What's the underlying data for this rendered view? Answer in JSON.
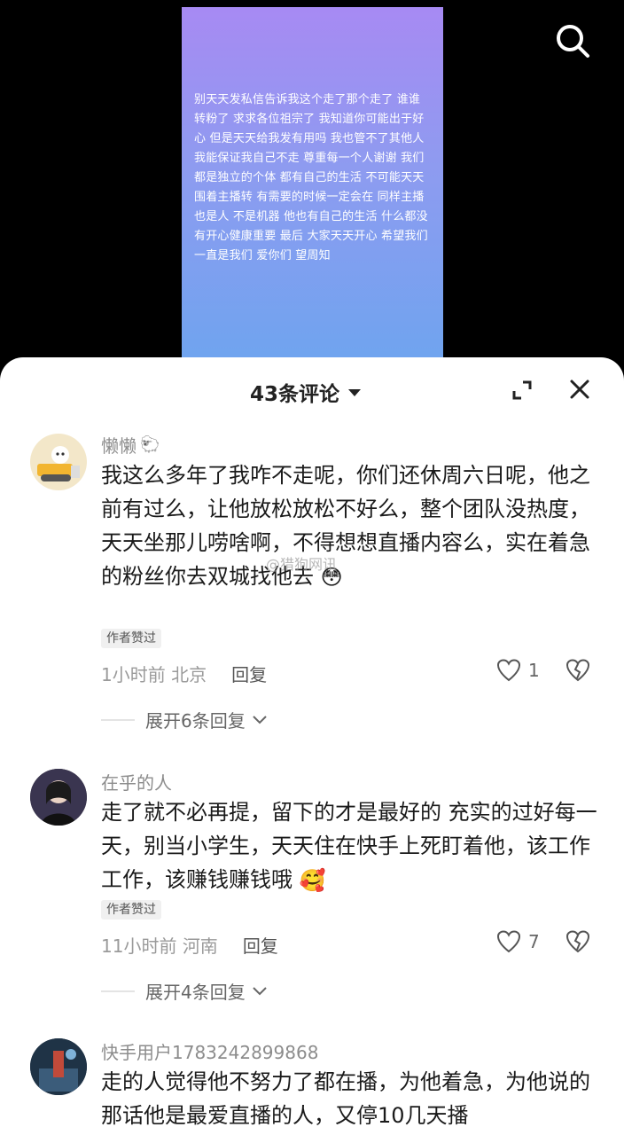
{
  "video": {
    "overlay_text": "别天天发私信告诉我这个走了那个走了 谁谁转粉了 求求各位祖宗了 我知道你可能出于好心 但是天天给我发有用吗 我也管不了其他人 我能保证我自己不走 尊重每一个人谢谢 我们都是独立的个体 都有自己的生活 不可能天天围着主播转 有需要的时候一定会在 同样主播也是人 不是机器 他也有自己的生活 什么都没有开心健康重要 最后 大家天天开心 希望我们一直是我们 爱你们 望周知"
  },
  "sheet": {
    "comment_count": "43条评论"
  },
  "comments": [
    {
      "username": "懒懒",
      "text": "我这么多年了我咋不走呢，你们还休周六日呢，他之前有过么，让他放松放松不好么，整个团队没热度，天天坐那儿唠啥啊，不得想想直播内容么，实在着急的粉丝你去双城找他去",
      "badge": "作者赞过",
      "time": "1小时前",
      "location": "北京",
      "reply_label": "回复",
      "likes": "1",
      "expand_label": "展开6条回复"
    },
    {
      "username": "在乎的人",
      "text": "走了就不必再提，留下的才是最好的 充实的过好每一天，别当小学生，天天住在快手上死盯着他，该工作工作，该赚钱赚钱哦",
      "badge": "作者赞过",
      "time": "11小时前",
      "location": "河南",
      "reply_label": "回复",
      "likes": "7",
      "expand_label": "展开4条回复"
    },
    {
      "username": "快手用户1783242899868",
      "text": "走的人觉得他不努力了都在播，为他着急，为他说的那话他是最爱直播的人，又停10几天播"
    }
  ],
  "watermark": "@猎狗网讯"
}
